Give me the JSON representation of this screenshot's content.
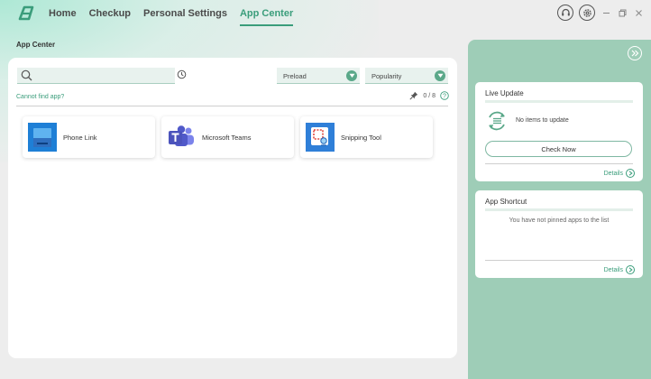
{
  "nav": {
    "items": [
      {
        "label": "Home",
        "active": false
      },
      {
        "label": "Checkup",
        "active": false
      },
      {
        "label": "Personal Settings",
        "active": false
      },
      {
        "label": "App Center",
        "active": true
      }
    ]
  },
  "colors": {
    "accent": "#3a9d7b",
    "right_panel": "#9ecdb7",
    "field_bg": "#e8f2ee"
  },
  "page": {
    "title": "App Center"
  },
  "search": {
    "value": "",
    "placeholder": ""
  },
  "filters": {
    "preload": "Preload",
    "sort": "Popularity"
  },
  "cannot_find": "Cannot find app?",
  "pinned_count": "0 / 8",
  "apps": [
    {
      "name": "Phone Link",
      "icon": "phone-link-icon"
    },
    {
      "name": "Microsoft Teams",
      "icon": "teams-icon"
    },
    {
      "name": "Snipping Tool",
      "icon": "snipping-tool-icon"
    }
  ],
  "live_update": {
    "title": "Live Update",
    "status": "No items to update",
    "button": "Check Now",
    "details": "Details"
  },
  "app_shortcut": {
    "title": "App Shortcut",
    "empty_text": "You have not pinned apps to the list",
    "details": "Details"
  }
}
